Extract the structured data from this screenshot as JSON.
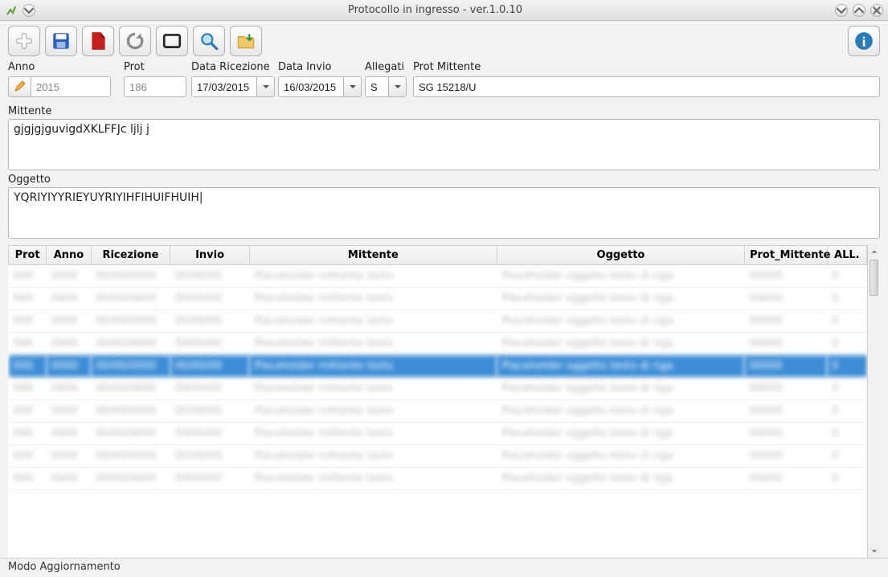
{
  "window": {
    "title": "Protocollo in ingresso - ver.1.0.10"
  },
  "toolbar": {
    "icons": [
      "plus",
      "save",
      "pdf",
      "refresh",
      "window",
      "search",
      "folder",
      "info"
    ]
  },
  "fields": {
    "anno": {
      "label": "Anno",
      "value": "2015"
    },
    "prot": {
      "label": "Prot",
      "value": "186"
    },
    "data_ricezione": {
      "label": "Data Ricezione",
      "value": "17/03/2015"
    },
    "data_invio": {
      "label": "Data Invio",
      "value": "16/03/2015"
    },
    "allegati": {
      "label": "Allegati",
      "value": "S"
    },
    "prot_mittente": {
      "label": "Prot Mittente",
      "value": "SG 15218/U"
    },
    "mittente": {
      "label": "Mittente",
      "value": "gjgjgjguvigdXKLFFJc ljlj j"
    },
    "oggetto": {
      "label": "Oggetto",
      "value": "YQRIYIYYRIEYUYRIYIHFIHUIFHUIH"
    }
  },
  "columns": {
    "prot": "Prot",
    "anno": "Anno",
    "ricezione": "Ricezione",
    "invio": "Invio",
    "mittente": "Mittente",
    "oggetto": "Oggetto",
    "prot_mittente": "Prot_Mittente",
    "all": "ALL."
  },
  "status": "Modo Aggiornamento"
}
